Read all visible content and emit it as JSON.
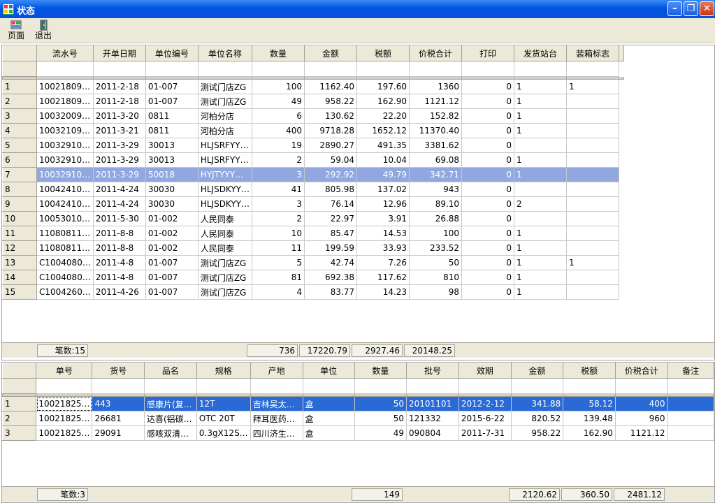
{
  "window": {
    "title": "状态"
  },
  "toolbar": {
    "page_label": "页面",
    "exit_label": "退出"
  },
  "grid1": {
    "columns": [
      "流水号",
      "开单日期",
      "单位编号",
      "单位名称",
      "数量",
      "金额",
      "税额",
      "价税合计",
      "打印",
      "发货站台",
      "装箱标志"
    ],
    "rows": [
      [
        "1",
        "10021809…",
        "2011-2-18",
        "01-007",
        "测试门店ZG",
        "100",
        "1162.40",
        "197.60",
        "1360",
        "0",
        "1",
        "1"
      ],
      [
        "2",
        "10021809…",
        "2011-2-18",
        "01-007",
        "测试门店ZG",
        "49",
        "958.22",
        "162.90",
        "1121.12",
        "0",
        "1",
        ""
      ],
      [
        "3",
        "10032009…",
        "2011-3-20",
        "0811",
        "河柏分店",
        "6",
        "130.62",
        "22.20",
        "152.82",
        "0",
        "1",
        ""
      ],
      [
        "4",
        "10032109…",
        "2011-3-21",
        "0811",
        "河柏分店",
        "400",
        "9718.28",
        "1652.12",
        "11370.40",
        "0",
        "1",
        ""
      ],
      [
        "5",
        "10032910…",
        "2011-3-29",
        "30013",
        "HLJSRFYY…",
        "19",
        "2890.27",
        "491.35",
        "3381.62",
        "0",
        "",
        ""
      ],
      [
        "6",
        "10032910…",
        "2011-3-29",
        "30013",
        "HLJSRFYY…",
        "2",
        "59.04",
        "10.04",
        "69.08",
        "0",
        "1",
        ""
      ],
      [
        "7",
        "10032910…",
        "2011-3-29",
        "50018",
        "HYJTYYY…",
        "3",
        "292.92",
        "49.79",
        "342.71",
        "0",
        "1",
        ""
      ],
      [
        "8",
        "10042410…",
        "2011-4-24",
        "30030",
        "HLJSDKYY…",
        "41",
        "805.98",
        "137.02",
        "943",
        "0",
        "",
        ""
      ],
      [
        "9",
        "10042410…",
        "2011-4-24",
        "30030",
        "HLJSDKYY…",
        "3",
        "76.14",
        "12.96",
        "89.10",
        "0",
        "2",
        ""
      ],
      [
        "10",
        "10053010…",
        "2011-5-30",
        "01-002",
        "人民同泰",
        "2",
        "22.97",
        "3.91",
        "26.88",
        "0",
        "",
        ""
      ],
      [
        "11",
        "11080811…",
        "2011-8-8",
        "01-002",
        "人民同泰",
        "10",
        "85.47",
        "14.53",
        "100",
        "0",
        "1",
        ""
      ],
      [
        "12",
        "11080811…",
        "2011-8-8",
        "01-002",
        "人民同泰",
        "11",
        "199.59",
        "33.93",
        "233.52",
        "0",
        "1",
        ""
      ],
      [
        "13",
        "C1004080…",
        "2011-4-8",
        "01-007",
        "测试门店ZG",
        "5",
        "42.74",
        "7.26",
        "50",
        "0",
        "1",
        "1"
      ],
      [
        "14",
        "C1004080…",
        "2011-4-8",
        "01-007",
        "测试门店ZG",
        "81",
        "692.38",
        "117.62",
        "810",
        "0",
        "1",
        ""
      ],
      [
        "15",
        "C1004260…",
        "2011-4-26",
        "01-007",
        "测试门店ZG",
        "4",
        "83.77",
        "14.23",
        "98",
        "0",
        "1",
        ""
      ]
    ],
    "selected_row": 7,
    "footer": {
      "count": "笔数:15",
      "qty": "736",
      "amount": "17220.79",
      "tax": "2927.46",
      "total": "20148.25"
    }
  },
  "grid2": {
    "columns": [
      "单号",
      "货号",
      "品名",
      "规格",
      "产地",
      "单位",
      "数量",
      "批号",
      "效期",
      "金额",
      "税额",
      "价税合计",
      "备注"
    ],
    "rows": [
      [
        "1",
        "10021825…",
        "443",
        "感康片(复…",
        "12T",
        "吉林吴太…",
        "盒",
        "50",
        "20101101",
        "2012-2-12",
        "341.88",
        "58.12",
        "400",
        ""
      ],
      [
        "2",
        "10021825…",
        "26681",
        "达喜(铝碳…",
        "OTC 20T",
        "拜耳医药…",
        "盒",
        "50",
        "121332",
        "2015-6-22",
        "820.52",
        "139.48",
        "960",
        ""
      ],
      [
        "3",
        "10021825…",
        "29091",
        "感咳双清…",
        "0.3gX12S…",
        "四川济生…",
        "盒",
        "49",
        "090804",
        "2011-7-31",
        "958.22",
        "162.90",
        "1121.12",
        ""
      ]
    ],
    "selected_row": 1,
    "footer": {
      "count": "笔数:3",
      "qty": "149",
      "amount": "2120.62",
      "tax": "360.50",
      "total": "2481.12"
    }
  }
}
